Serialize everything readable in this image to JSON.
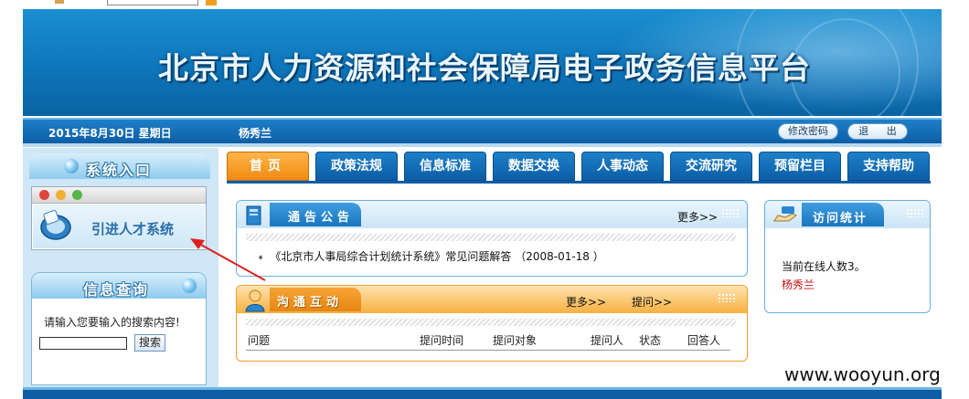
{
  "banner": {
    "title": "北京市人力资源和社会保障局电子政务信息平台"
  },
  "status": {
    "date": "2015年8月30日 星期日",
    "user": "杨秀兰",
    "change_password": "修改密码",
    "logout": "退 出"
  },
  "sidebar": {
    "entry_title": "系统入口",
    "system_link": "引进人才系统",
    "query_title": "信息查询",
    "query_hint": "请输入您要输入的搜索内容!",
    "search_value": "",
    "search_button": "搜索"
  },
  "tabs": [
    "首页",
    "政策法规",
    "信息标准",
    "数据交换",
    "人事动态",
    "交流研究",
    "预留栏目",
    "支持帮助"
  ],
  "notice": {
    "title": "通告公告",
    "more": "更多>>",
    "items": [
      "《北京市人事局综合计划统计系统》常见问题解答 （2008-01-18 ）"
    ]
  },
  "comm": {
    "title": "沟通互动",
    "more": "更多>>",
    "ask": "提问>>",
    "columns": [
      "问题",
      "提问时间",
      "提问对象",
      "提问人",
      "状态",
      "回答人"
    ]
  },
  "stats": {
    "title": "访问统计",
    "online": "当前在线人数3。",
    "user": "杨秀兰"
  },
  "watermark": "www.wooyun.org",
  "colors": {
    "primary": "#0f78bd",
    "active_tab": "#f08a10",
    "arrow": "#e02020"
  }
}
